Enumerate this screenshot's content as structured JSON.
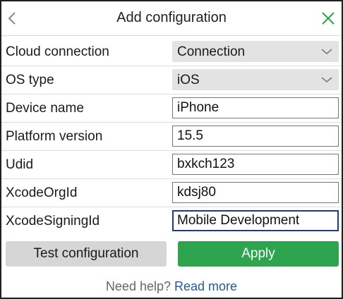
{
  "header": {
    "title": "Add configuration",
    "back_icon": "chevron-left-icon",
    "close_icon": "close-icon",
    "close_color": "#2ea44f"
  },
  "form": {
    "cloud_connection": {
      "label": "Cloud connection",
      "value": "Connection"
    },
    "os_type": {
      "label": "OS type",
      "value": "iOS"
    },
    "device_name": {
      "label": "Device name",
      "value": "iPhone"
    },
    "platform_version": {
      "label": "Platform version",
      "value": "15.5"
    },
    "udid": {
      "label": "Udid",
      "value": "bxkch123"
    },
    "xcode_org_id": {
      "label": "XcodeOrgId",
      "value": "kdsj80"
    },
    "xcode_signing_id": {
      "label": "XcodeSigningId",
      "value": "Mobile Development"
    }
  },
  "actions": {
    "test_label": "Test configuration",
    "apply_label": "Apply",
    "apply_color": "#2ea44f"
  },
  "help": {
    "text": "Need help?",
    "link_label": "Read more"
  }
}
